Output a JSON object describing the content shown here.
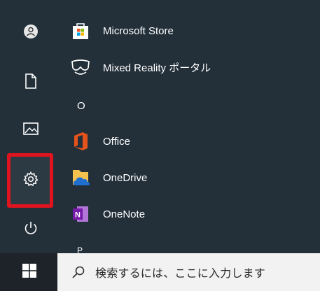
{
  "start_menu": {
    "apps": [
      {
        "label": "Microsoft Store",
        "icon": "microsoft-store-icon"
      },
      {
        "label": "Mixed Reality ポータル",
        "icon": "mixed-reality-portal-icon"
      },
      {
        "label": "Office",
        "icon": "office-icon"
      },
      {
        "label": "OneDrive",
        "icon": "onedrive-icon"
      },
      {
        "label": "OneNote",
        "icon": "onenote-icon"
      }
    ],
    "section_letters": [
      "O",
      "P"
    ],
    "rail_icons": [
      "user-avatar-icon",
      "documents-icon",
      "pictures-icon",
      "settings-icon",
      "power-icon"
    ]
  },
  "taskbar": {
    "search_placeholder": "検索するには、ここに入力します",
    "start_icon": "windows-logo-icon"
  },
  "colors": {
    "panel_bg": "#23303a",
    "highlight": "#e0141e",
    "taskbar_bg": "#1d2328"
  }
}
